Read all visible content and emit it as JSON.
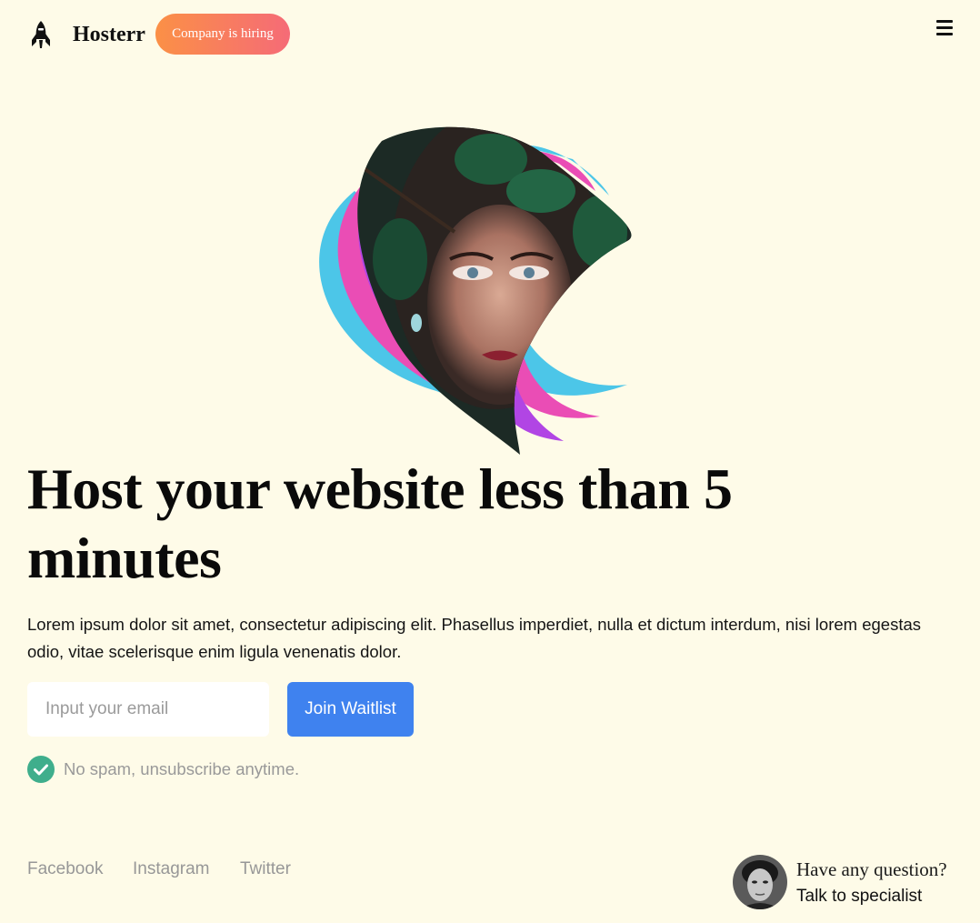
{
  "header": {
    "logo_icon": "rocket-icon",
    "brand": "Hosterr",
    "hiring_badge": "Company is hiring",
    "menu_icon": "hamburger-menu-icon"
  },
  "hero": {
    "headline": "Host your website less than 5 minutes",
    "description": "Lorem ipsum dolor sit amet, consectetur adipiscing elit. Phasellus imperdiet, nulla et dictum interdum, nisi lorem egestas odio, vitae scelerisque enim ligula venenatis dolor.",
    "email_placeholder": "Input your email",
    "email_value": "",
    "cta_label": "Join Waitlist",
    "check_icon": "check-circle-icon",
    "note": "No spam, unsubscribe anytime."
  },
  "footer": {
    "social_links": [
      "Facebook",
      "Instagram",
      "Twitter"
    ],
    "question": "Have any question?",
    "talk_label": "Talk to specialist"
  },
  "colors": {
    "background": "#fefbe8",
    "hiring_gradient_start": "#fb9046",
    "hiring_gradient_end": "#f56b77",
    "cta": "#3f82ef",
    "check": "#3fae8c",
    "wave_purple": "#b145e4",
    "wave_pink": "#ea4db5",
    "wave_cyan": "#4cc6e8"
  }
}
